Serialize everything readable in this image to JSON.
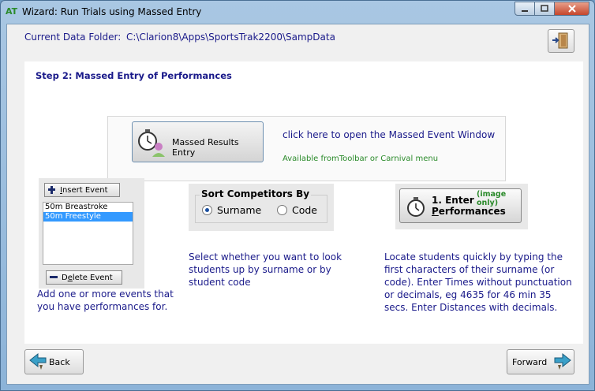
{
  "window": {
    "title": "Wizard:  Run Trials using Massed Entry",
    "app_icon": "AT"
  },
  "header": {
    "folder_label": "Current Data Folder:",
    "folder_path": "C:\\Clarion8\\Apps\\SportsTrak2200\\SampData"
  },
  "step": {
    "title": "Step 2: Massed Entry of Performances"
  },
  "massed": {
    "button_label": "Massed Results Entry",
    "link_text": "click here to open the Massed Event Window",
    "available_text": "Available fromToolbar or Carnival menu"
  },
  "events": {
    "insert_label_underline": "I",
    "insert_label_rest": "nsert Event",
    "items": [
      "50m Breastroke",
      "50m Freestyle"
    ],
    "selected_index": 1,
    "delete_label_pre": "D",
    "delete_label_underline": "e",
    "delete_label_rest": "lete Event",
    "description": "Add one or more events that you have performances for."
  },
  "sort": {
    "title": "Sort Competitors By",
    "options": [
      "Surname",
      "Code"
    ],
    "selected": "Surname",
    "description": "Select whether you want to look students up by surname or by student code"
  },
  "enter": {
    "line1": "1. Enter",
    "line2_underline": "P",
    "line2_rest": "erformances",
    "note": "(image only)",
    "description": "Locate students quickly by typing the first characters of their surname (or code).  Enter Times without punctuation or decimals, eg 4635 for 46 min 35 secs.  Enter Distances with decimals."
  },
  "nav": {
    "back_label": "Back",
    "forward_label": "Forward"
  },
  "colors": {
    "accent_text": "#1a1a8a",
    "green_text": "#2a8a2a",
    "selection": "#3399ff"
  }
}
